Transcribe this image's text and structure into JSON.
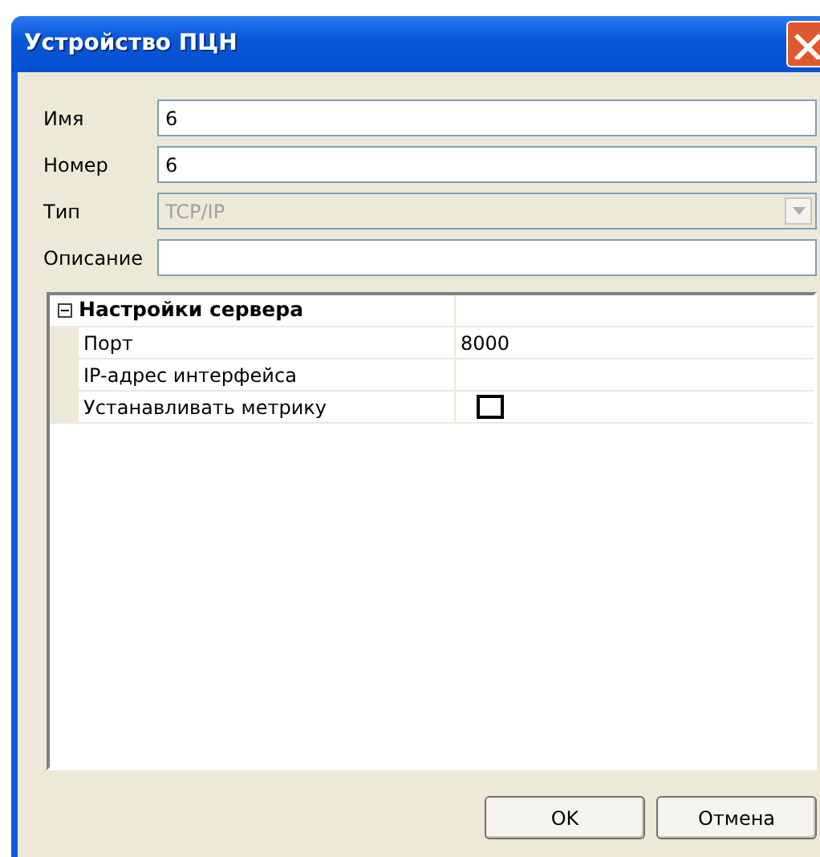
{
  "window": {
    "title": "Устройство ПЦН"
  },
  "fields": [
    {
      "label": "Имя",
      "kind": "text",
      "value": "6",
      "disabled": false
    },
    {
      "label": "Номер",
      "kind": "text",
      "value": "6",
      "disabled": false
    },
    {
      "label": "Тип",
      "kind": "combo",
      "value": "TCP/IP",
      "disabled": true
    },
    {
      "label": "Описание",
      "kind": "text",
      "disabled": false
    }
  ],
  "property_grid": {
    "section": {
      "title": "Настройки сервера",
      "expanded": true
    },
    "rows": [
      {
        "name": "Порт",
        "kind": "text",
        "value": "8000"
      },
      {
        "name": "IP-адрес интерфейса",
        "kind": "text"
      },
      {
        "name": "Устанавливать метрику",
        "kind": "checkbox",
        "checked": false
      }
    ]
  },
  "buttons": [
    {
      "label": "OK"
    },
    {
      "label": "Отмена"
    }
  ]
}
